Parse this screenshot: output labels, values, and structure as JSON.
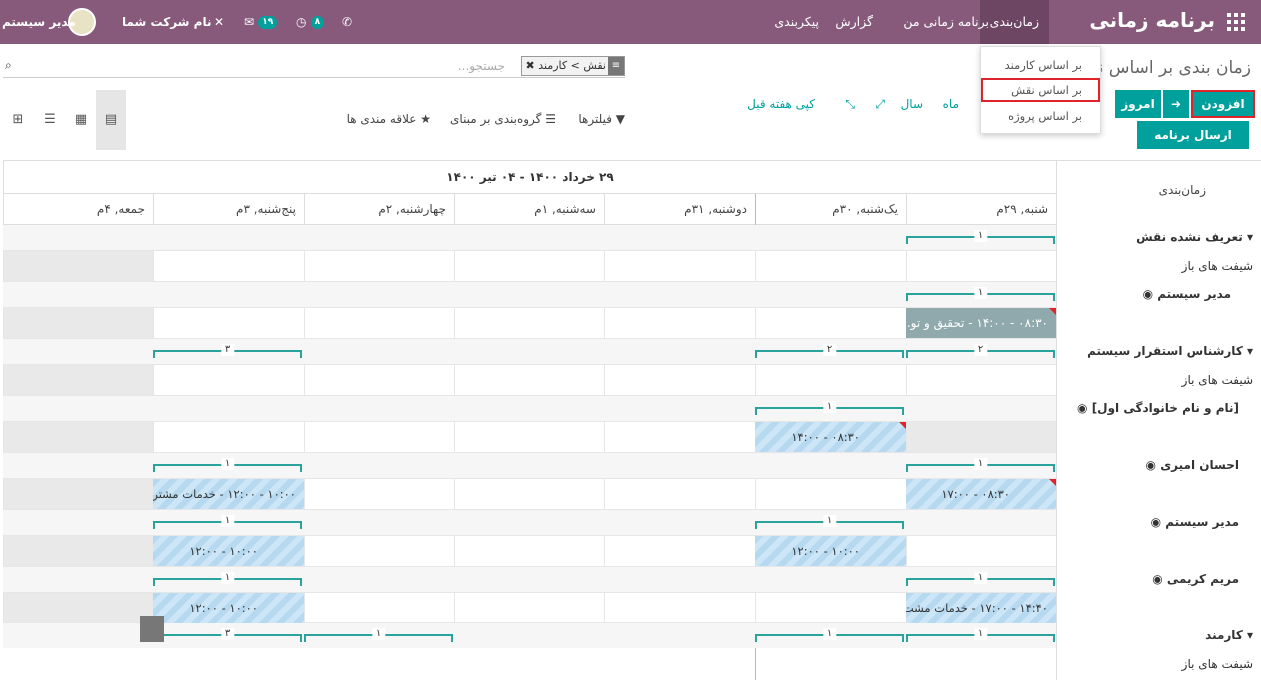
{
  "topbar": {
    "app_title": "برنامه زمانی",
    "menus": [
      "زمان‌بندی",
      "برنامه زمانی من",
      "گزارش",
      "پیکربندی"
    ],
    "company": "نام شرکت شما",
    "user": "مدیر سیستم",
    "activity_count": "۸",
    "messages_count": "۱۹"
  },
  "dropdown": [
    "بر اساس کارمند",
    "بر اساس نقش",
    "بر اساس پروژه"
  ],
  "control": {
    "title": "زمان بندی بر اساس نقش",
    "facet": "نقش > کارمند",
    "search_placeholder": "جستجو...",
    "add": "افزودن",
    "today": "امروز",
    "send": "ارسال برنامه زمانی",
    "scales": [
      "ماه",
      "سال"
    ],
    "copy_prev": "کپی هفته قبل",
    "filters": "فیلترها",
    "groupby": "گروه‌بندی بر مبنای",
    "favorites": "علاقه مندی ها"
  },
  "grid": {
    "row_header": "زمان‌بندی",
    "range": "۲۹ خرداد ۱۴۰۰ - ۰۴ تیر ۱۴۰۰",
    "days": [
      "شنبه, ۲۹م",
      "یک‌شنبه, ۳۰م",
      "دوشنبه, ۳۱م",
      "سه‌شنبه, ۱م",
      "چهارشنبه, ۲م",
      "پنج‌شنبه, ۳م",
      "جمعه, ۴م"
    ],
    "rows": [
      {
        "label": "تعریف نشده نقش",
        "type": "group"
      },
      {
        "label": "شیفت های باز",
        "type": "sub"
      },
      {
        "label": "مدیر سیستم",
        "type": "user"
      },
      {
        "label": "کارشناس استقرار سیستم",
        "type": "group"
      },
      {
        "label": "شیفت های باز",
        "type": "sub"
      },
      {
        "label": "[نام و نام خانوادگی اول]",
        "type": "user"
      },
      {
        "label": "احسان امیری",
        "type": "user"
      },
      {
        "label": "مدیر سیستم",
        "type": "user"
      },
      {
        "label": "مریم کریمی",
        "type": "user"
      },
      {
        "label": "کارمند",
        "type": "group"
      },
      {
        "label": "شیفت های باز",
        "type": "sub"
      }
    ],
    "counts": {
      "one": "۱",
      "two": "۲",
      "three": "۳"
    },
    "pills": {
      "p1": "۰۸:۳۰ - ۱۴:۰۰ - تحقیق و تو...",
      "p2": "۰۸:۳۰ - ۱۴:۰۰",
      "p3": "۰۸:۳۰ - ۱۷:۰۰",
      "p4": "۱۰:۰۰ - ۱۲:۰۰ - خدمات مشتر...",
      "p5": "۱۰:۰۰ - ۱۲:۰۰",
      "p6": "۱۰:۰۰ - ۱۲:۰۰",
      "p7": "۱۴:۴۰ - ۱۷:۰۰ - خدمات مشت...",
      "p8": "۱۰:۰۰ - ۱۲:۰۰"
    }
  }
}
